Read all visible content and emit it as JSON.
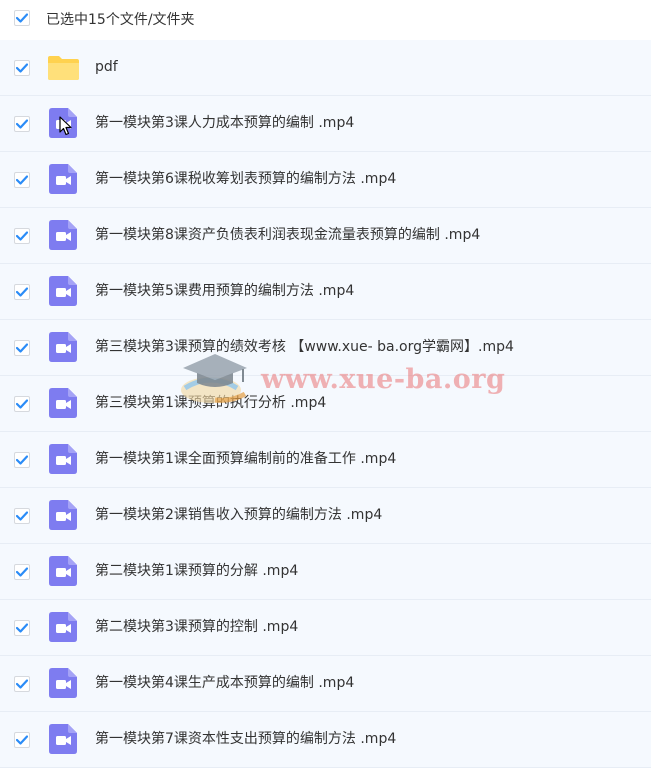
{
  "header": {
    "selection_label": "已选中15个文件/文件夹",
    "checked": true
  },
  "colors": {
    "checkbox": "#2b8cf7",
    "folder": "#ffd24f",
    "video": "#7e7cf0",
    "row_bg": "#f5f9fe"
  },
  "files": [
    {
      "name": "pdf",
      "type": "folder",
      "icon": "folder-icon",
      "checked": true
    },
    {
      "name": "第一模块第3课人力成本预算的编制 .mp4",
      "type": "video",
      "icon": "video-icon",
      "checked": true
    },
    {
      "name": "第一模块第6课税收筹划表预算的编制方法 .mp4",
      "type": "video",
      "icon": "video-icon",
      "checked": true
    },
    {
      "name": "第一模块第8课资产负债表利润表现金流量表预算的编制 .mp4",
      "type": "video",
      "icon": "video-icon",
      "checked": true
    },
    {
      "name": "第一模块第5课费用预算的编制方法 .mp4",
      "type": "video",
      "icon": "video-icon",
      "checked": true
    },
    {
      "name": "第三模块第3课预算的绩效考核 【www.xue- ba.org学霸网】.mp4",
      "type": "video",
      "icon": "video-icon",
      "checked": true
    },
    {
      "name": "第三模块第1课预算的执行分析 .mp4",
      "type": "video",
      "icon": "video-icon",
      "checked": true
    },
    {
      "name": "第一模块第1课全面预算编制前的准备工作 .mp4",
      "type": "video",
      "icon": "video-icon",
      "checked": true
    },
    {
      "name": "第一模块第2课销售收入预算的编制方法 .mp4",
      "type": "video",
      "icon": "video-icon",
      "checked": true
    },
    {
      "name": "第二模块第1课预算的分解 .mp4",
      "type": "video",
      "icon": "video-icon",
      "checked": true
    },
    {
      "name": "第二模块第3课预算的控制 .mp4",
      "type": "video",
      "icon": "video-icon",
      "checked": true
    },
    {
      "name": "第一模块第4课生产成本预算的编制 .mp4",
      "type": "video",
      "icon": "video-icon",
      "checked": true
    },
    {
      "name": "第一模块第7课资本性支出预算的编制方法 .mp4",
      "type": "video",
      "icon": "video-icon",
      "checked": true
    }
  ],
  "watermark": {
    "text": "www.xue-ba.org"
  }
}
